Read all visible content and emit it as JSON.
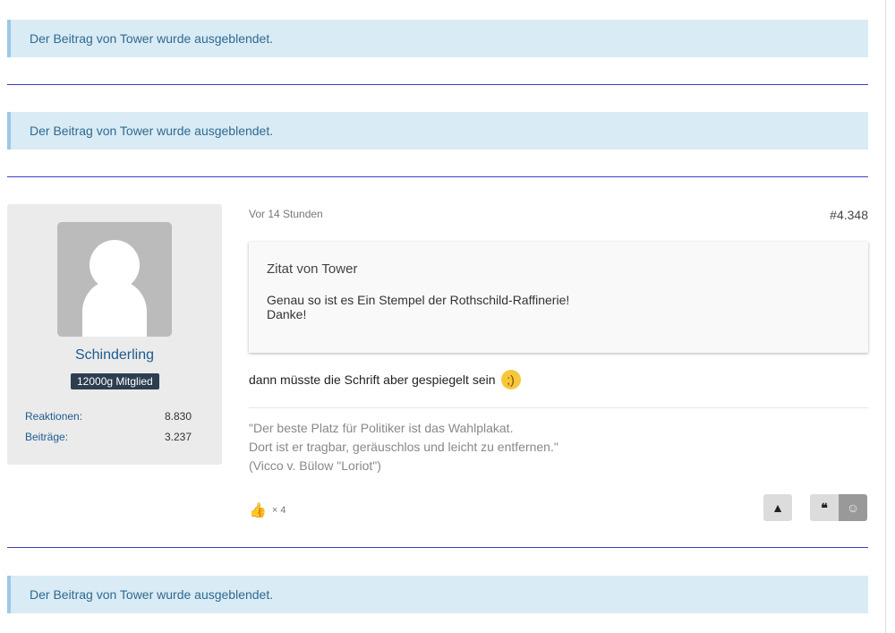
{
  "hidden_notices": [
    "Der Beitrag von Tower wurde ausgeblendet.",
    "Der Beitrag von Tower wurde ausgeblendet.",
    "Der Beitrag von Tower wurde ausgeblendet."
  ],
  "post": {
    "author": "Schinderling",
    "rank": "12000g Mitglied",
    "stats": [
      {
        "label": "Reaktionen:",
        "value": "8.830"
      },
      {
        "label": "Beiträge:",
        "value": "3.237"
      }
    ],
    "time": "Vor 14 Stunden",
    "number": "#4.348",
    "quote": {
      "title": "Zitat von Tower",
      "lines": [
        "Genau so ist es Ein Stempel der Rothschild-Raffinerie!",
        "Danke!"
      ]
    },
    "message": "dann müsste die Schrift aber gespiegelt sein",
    "signature": [
      "\"Der beste Platz für Politiker ist das Wahlplakat.",
      "Dort ist er tragbar, geräuschlos und leicht zu entfernen.\"",
      "(Vicco v. Bülow \"Loriot\")"
    ],
    "reaction_count": "× 4"
  }
}
